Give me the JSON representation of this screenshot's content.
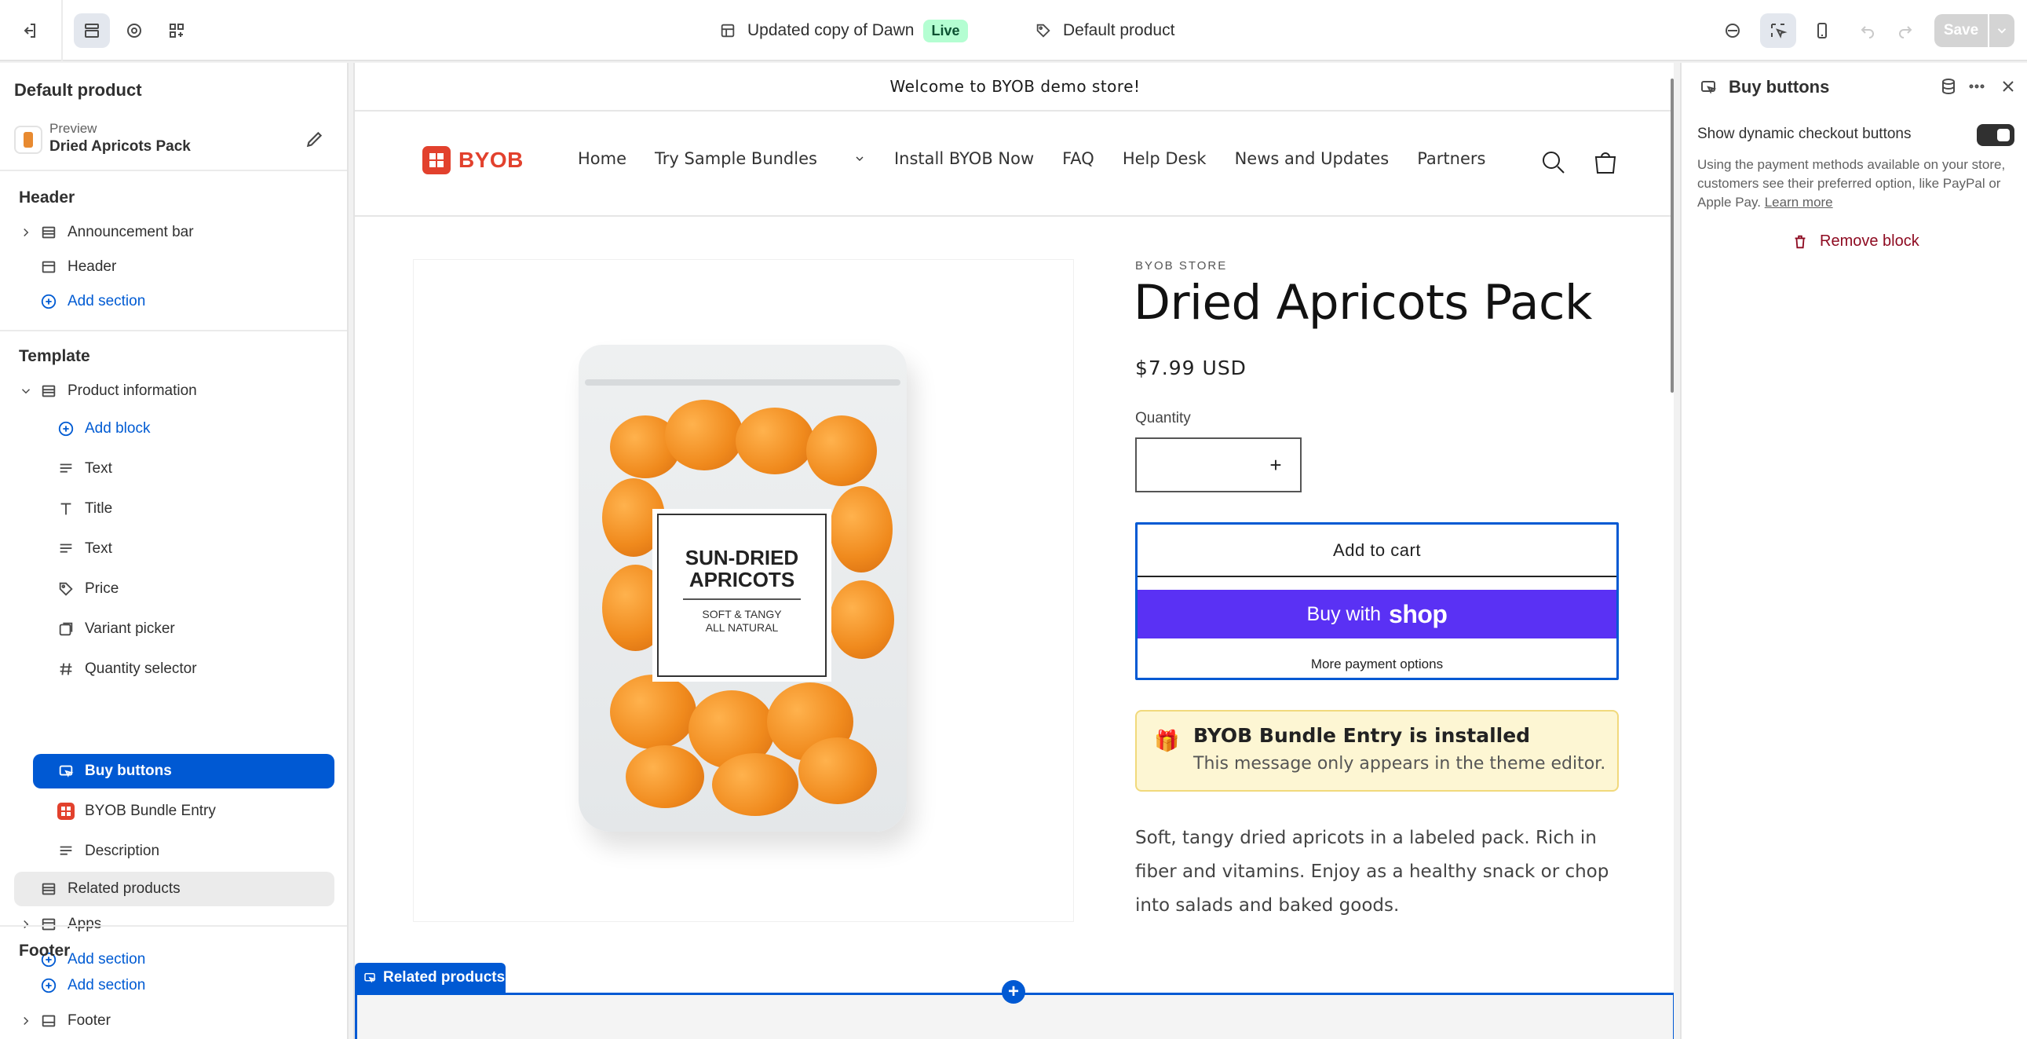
{
  "topbar": {
    "theme_name": "Updated copy of Dawn",
    "live_badge": "Live",
    "template_name": "Default product",
    "save_label": "Save"
  },
  "sidebar": {
    "title": "Default product",
    "preview_label": "Preview",
    "preview_product": "Dried Apricots Pack",
    "header_group": "Header",
    "header_items": [
      "Announcement bar",
      "Header"
    ],
    "add_section": "Add section",
    "template_group": "Template",
    "product_information": "Product information",
    "add_block": "Add block",
    "blocks": [
      "Text",
      "Title",
      "Text",
      "Price",
      "Variant picker",
      "Quantity selector",
      "Buy buttons",
      "BYOB Bundle Entry",
      "Description"
    ],
    "related_products": "Related products",
    "apps": "Apps",
    "footer_group": "Footer",
    "footer_item": "Footer"
  },
  "store": {
    "announcement": "Welcome to BYOB demo store!",
    "logo_text": "BYOB",
    "nav": [
      "Home",
      "Try Sample Bundles",
      "Install BYOB Now",
      "FAQ",
      "Help Desk",
      "News and Updates",
      "Partners"
    ],
    "vendor": "BYOB STORE",
    "product_title": "Dried Apricots Pack",
    "price": "$7.99 USD",
    "quantity_label": "Quantity",
    "quantity_plus": "+",
    "add_to_cart": "Add to cart",
    "buy_with": "Buy with",
    "buy_brand": "shop",
    "more_payment": "More payment options",
    "notice_title": "BYOB Bundle Entry is installed",
    "notice_sub": "This message only appears in the theme editor.",
    "description": "Soft, tangy dried apricots in a labeled pack. Rich in fiber and vitamins. Enjoy as a healthy snack or chop into salads and baked goods.",
    "bag_label_1": "SUN-DRIED",
    "bag_label_2": "APRICOTS",
    "bag_label_3": "SOFT & TANGY",
    "bag_label_4": "ALL NATURAL",
    "related_tag": "Related products"
  },
  "settings": {
    "title": "Buy buttons",
    "toggle_label": "Show dynamic checkout buttons",
    "toggle_on": true,
    "help_text": "Using the payment methods available on your store, customers see their preferred option, like PayPal or Apple Pay.",
    "learn_more": "Learn more",
    "remove_block": "Remove block"
  }
}
